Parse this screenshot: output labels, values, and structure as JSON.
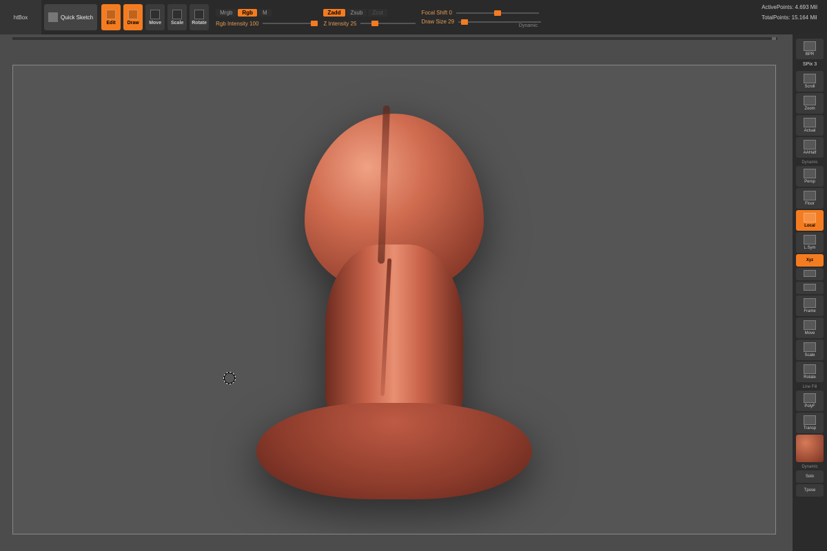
{
  "topbar": {
    "lightbox": "htBox",
    "quicksketch": "Quick Sketch",
    "mode_buttons": [
      {
        "label": "Edit",
        "active": true
      },
      {
        "label": "Draw",
        "active": true
      },
      {
        "label": "Move",
        "active": false
      },
      {
        "label": "Scale",
        "active": false
      },
      {
        "label": "Rotate",
        "active": false
      }
    ],
    "rgb_row": {
      "mrgb": "Mrgb",
      "rgb": "Rgb",
      "m": "M"
    },
    "rgb_intensity_label": "Rgb Intensity 100",
    "z_row": {
      "zadd": "Zadd",
      "zsub": "Zsub",
      "zcut": "Zcut"
    },
    "z_intensity_label": "Z Intensity 25",
    "focal_shift_label": "Focal Shift 0",
    "draw_size_label": "Draw Size 29",
    "dynamic_label": "Dynamic",
    "readouts": {
      "active": "ActivePoints: 4.693 Mil",
      "total": "TotalPoints: 15.164 Mil"
    }
  },
  "right_palette": {
    "top": "BPR",
    "spix": "SPix 3",
    "buttons": [
      {
        "label": "Scroll",
        "active": false
      },
      {
        "label": "Zoom",
        "active": false
      },
      {
        "label": "Actual",
        "active": false
      },
      {
        "label": "AAHalf",
        "active": false
      }
    ],
    "persp_section": "Dynamic",
    "persp": "Persp",
    "floor": "Floor",
    "local": {
      "label": "Local",
      "active": true
    },
    "lsym": "L.Sym",
    "xyz": {
      "label": "Xyz",
      "active": true
    },
    "row3": [
      {
        "label": ""
      },
      {
        "label": ""
      }
    ],
    "frame": "Frame",
    "nav": [
      "Move",
      "Scale",
      "Rotate"
    ],
    "linefill": "Line Fill",
    "polyf": "PolyF",
    "transp": "Transp",
    "dynamic2": "Dynamic",
    "solo": "Solo",
    "tpose": "Tpose"
  },
  "colors": {
    "accent": "#f47c20",
    "bg": "#404040",
    "panel": "#2b2b2b"
  }
}
